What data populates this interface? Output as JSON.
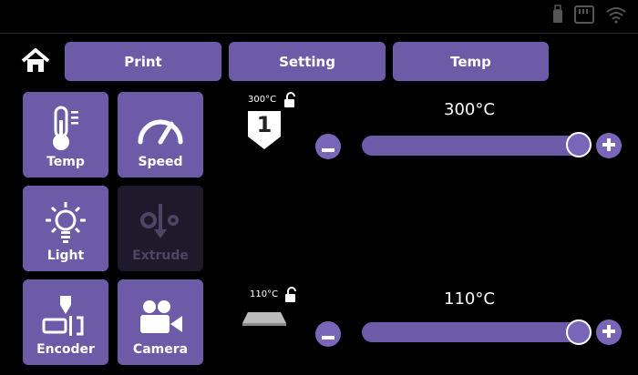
{
  "status_icons": [
    "usb-icon",
    "sd-card-icon",
    "wifi-icon"
  ],
  "tabs": [
    {
      "label": "Print"
    },
    {
      "label": "Setting"
    },
    {
      "label": "Temp"
    }
  ],
  "tiles": [
    {
      "label": "Temp",
      "icon": "thermometer-icon",
      "enabled": true
    },
    {
      "label": "Speed",
      "icon": "speedometer-icon",
      "enabled": true
    },
    {
      "label": "Light",
      "icon": "lightbulb-icon",
      "enabled": true
    },
    {
      "label": "Extrude",
      "icon": "extruder-icon",
      "enabled": false
    },
    {
      "label": "Encoder",
      "icon": "encoder-icon",
      "enabled": true
    },
    {
      "label": "Camera",
      "icon": "camera-icon",
      "enabled": true
    }
  ],
  "nozzle": {
    "max_label": "300°C",
    "number": "1",
    "value_label": "300°C",
    "slider_fraction": 1.0
  },
  "bed": {
    "max_label": "110°C",
    "value_label": "110°C",
    "slider_fraction": 1.0
  },
  "colors": {
    "accent": "#6e5ba8",
    "disabled": "#1f1a2b",
    "background": "#000000"
  }
}
